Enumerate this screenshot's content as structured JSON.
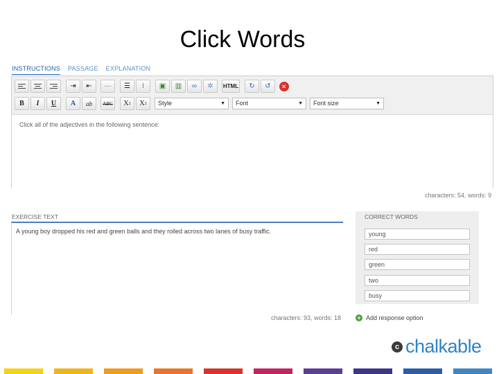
{
  "slide": {
    "title": "Click Words"
  },
  "tabs": [
    {
      "label": "INSTRUCTIONS",
      "active": true
    },
    {
      "label": "PASSAGE",
      "active": false
    },
    {
      "label": "EXPLANATION",
      "active": false
    }
  ],
  "toolbar": {
    "row1_icons": [
      "align-left-icon",
      "align-center-icon",
      "align-right-icon",
      "outdent-icon",
      "horizontal-rule-icon",
      "numbered-list-icon",
      "bulleted-list-icon",
      "image-icon",
      "video-icon",
      "link-icon",
      "special-char-icon",
      "html-source-icon",
      "redo-icon",
      "undo-icon",
      "remove-icon"
    ],
    "html_label": "HTML",
    "bold": "B",
    "italic": "I",
    "underline": "U",
    "font_color": "A",
    "highlight": "ab",
    "strikethrough": "ABC",
    "subscript": "X",
    "superscript": "X",
    "style_select": "Style",
    "font_select": "Font",
    "font_size_select": "Font size"
  },
  "instructions": {
    "text": "Click all of the adjectives in the following sentence:",
    "counter": "characters: 54, words: 9"
  },
  "exercise": {
    "label": "EXERCISE TEXT",
    "text": "A young boy dropped his red and green balls and they rolled across two lanes of busy traffic.",
    "counter": "characters: 93, words: 18"
  },
  "correct_words": {
    "label": "CORRECT WORDS",
    "items": [
      "young",
      "red",
      "green",
      "two",
      "busy"
    ],
    "add_label": "Add response option"
  },
  "brand": {
    "name": "chalkable",
    "color": "#2f83c5"
  },
  "footer_colors": [
    "#f2d21a",
    "#f0b41c",
    "#ee9b1f",
    "#e8752a",
    "#d9332c",
    "#c2245e",
    "#5a3f95",
    "#3d3588",
    "#2c5ea8",
    "#3f87c4"
  ]
}
